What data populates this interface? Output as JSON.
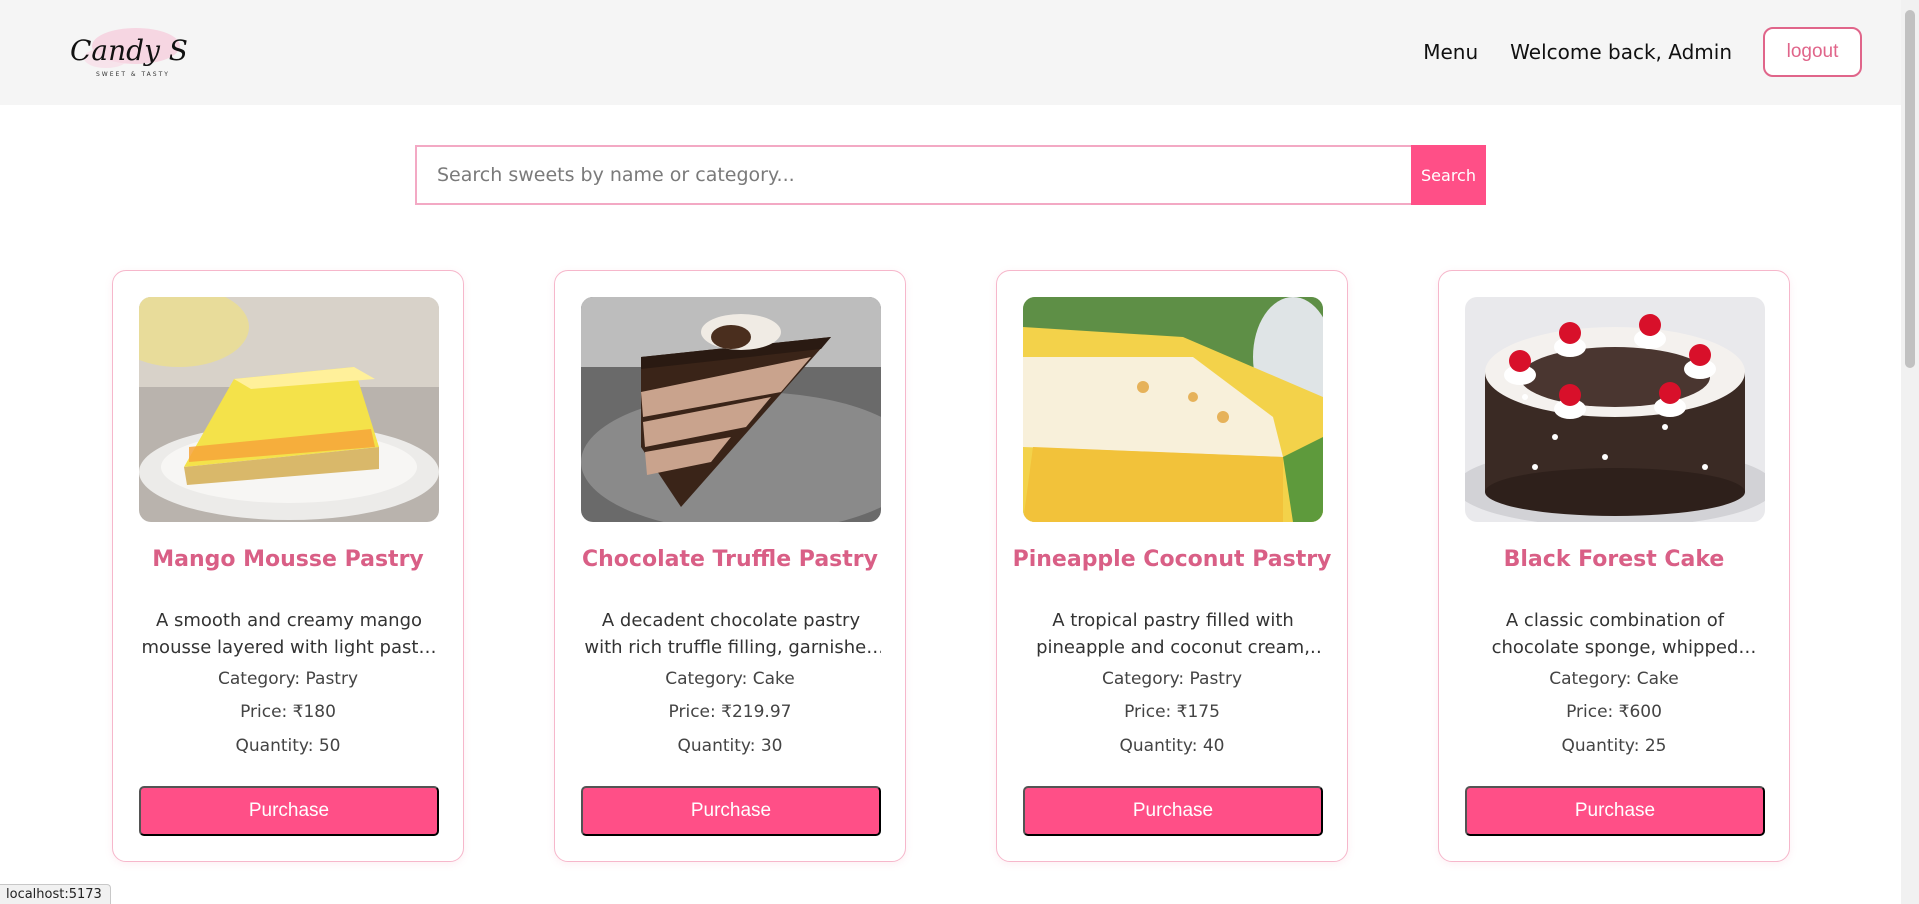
{
  "header": {
    "logo_text": "Candy Shop",
    "logo_tagline": "SWEET & TASTY",
    "nav_menu": "Menu",
    "welcome": "Welcome back, Admin",
    "logout": "logout"
  },
  "search": {
    "placeholder": "Search sweets by name or category...",
    "button": "Search"
  },
  "products": [
    {
      "name": "Mango Mousse Pastry",
      "description": "A smooth and creamy mango mousse layered with light pastry sponge.",
      "category": "Category: Pastry",
      "price": "Price: ₹180",
      "quantity": "Quantity: 50",
      "button": "Purchase"
    },
    {
      "name": "Chocolate Truffle Pastry",
      "description": "A decadent chocolate pastry with rich truffle filling, garnished with chocolate.",
      "category": "Category: Cake",
      "price": "Price: ₹219.97",
      "quantity": "Quantity: 30",
      "button": "Purchase"
    },
    {
      "name": "Pineapple Coconut Pastry",
      "description": "A tropical pastry filled with pineapple and coconut cream, topped with flakes.",
      "category": "Category: Pastry",
      "price": "Price: ₹175",
      "quantity": "Quantity: 40",
      "button": "Purchase"
    },
    {
      "name": "Black Forest Cake",
      "description": "A classic combination of chocolate sponge, whipped cream, cherries and shavings.",
      "category": "Category: Cake",
      "price": "Price: ₹600",
      "quantity": "Quantity: 25",
      "button": "Purchase"
    }
  ],
  "statusbar": {
    "url": "localhost:5173"
  },
  "colors": {
    "accent": "#ff4f87",
    "title": "#d95f86",
    "border": "#f6b7cb",
    "header_bg": "#f5f5f5"
  }
}
